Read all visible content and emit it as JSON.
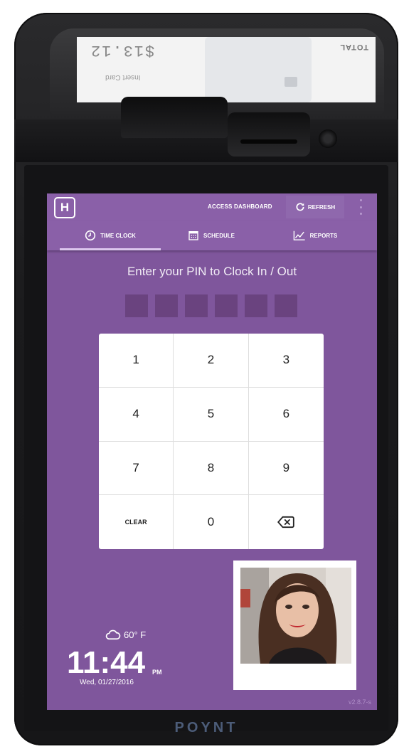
{
  "device": {
    "brand": "POYNT",
    "customer_screen": {
      "amount": "$13.12",
      "total_label": "TOTAL",
      "insert_label": "Insert Card"
    }
  },
  "header": {
    "logo_letter": "H",
    "access_dashboard": "ACCESS DASHBOARD",
    "refresh": "REFRESH"
  },
  "tabs": [
    {
      "label": "TIME CLOCK",
      "icon": "clock-icon",
      "active": true
    },
    {
      "label": "SCHEDULE",
      "icon": "calendar-icon",
      "active": false
    },
    {
      "label": "REPORTS",
      "icon": "chart-icon",
      "active": false
    }
  ],
  "pin": {
    "prompt": "Enter your PIN to Clock In / Out",
    "length": 6
  },
  "keypad": {
    "k1": "1",
    "k2": "2",
    "k3": "3",
    "k4": "4",
    "k5": "5",
    "k6": "6",
    "k7": "7",
    "k8": "8",
    "k9": "9",
    "clear": "CLEAR",
    "k0": "0",
    "backspace_icon": "backspace-icon"
  },
  "status": {
    "weather_icon": "cloud-icon",
    "temperature": "60° F",
    "time": "11:44",
    "ampm": "PM",
    "date": "Wed, 01/27/2016",
    "version": "v2.8.7-s"
  },
  "colors": {
    "primary": "#7f569c",
    "header": "#8a60a8",
    "pin_box": "#6a437f",
    "tab_indicator": "#dcc6ee"
  }
}
